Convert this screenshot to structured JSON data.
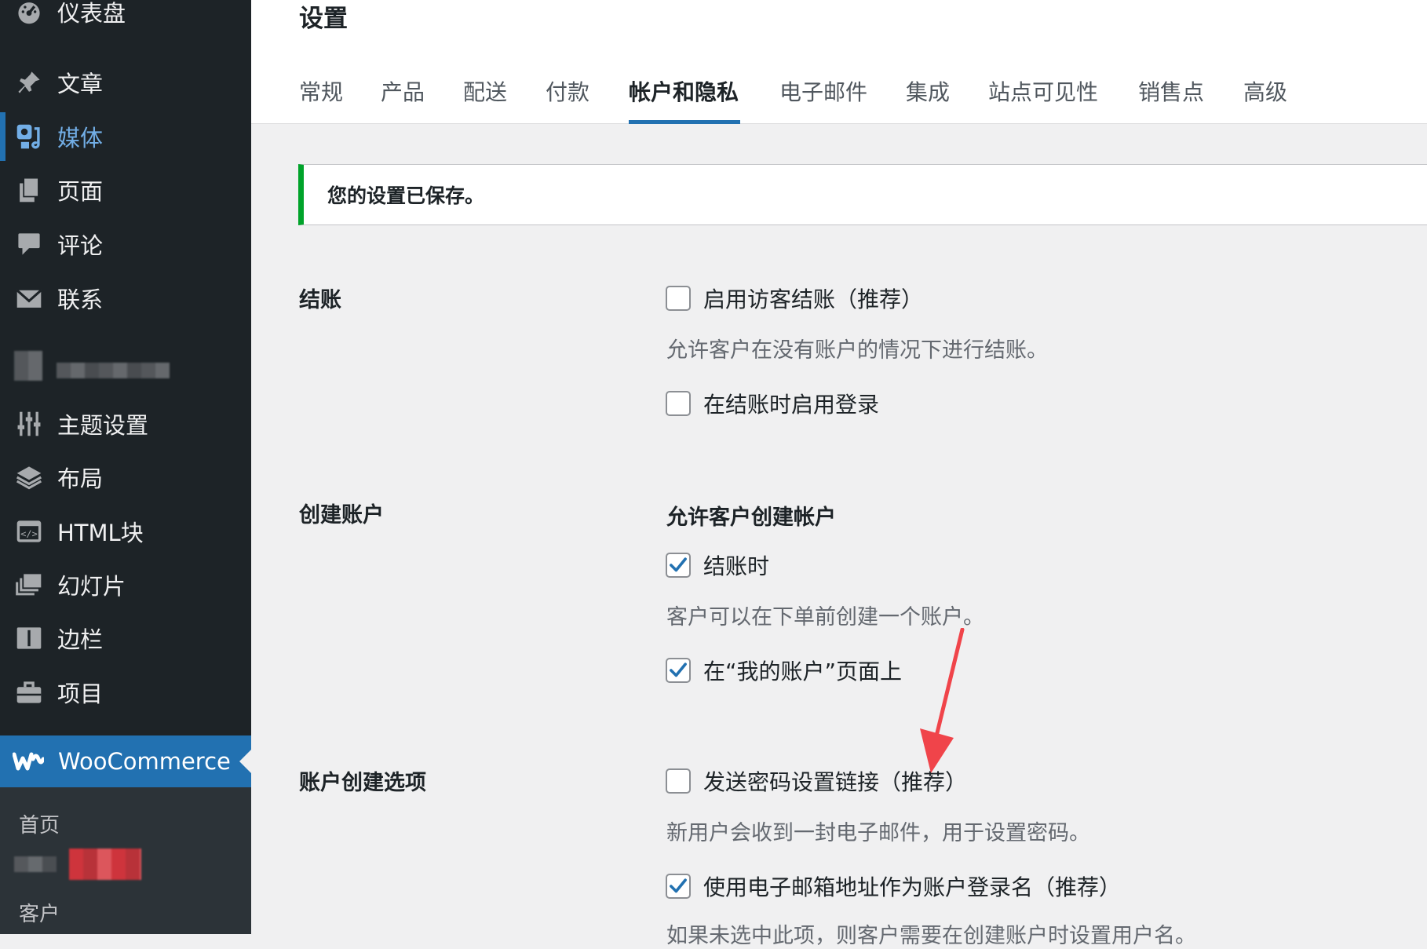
{
  "sidebar": {
    "items": [
      {
        "label": "仪表盘",
        "icon": "dashboard-icon"
      },
      {
        "label": "文章",
        "icon": "pin-icon"
      },
      {
        "label": "媒体",
        "icon": "media-icon"
      },
      {
        "label": "页面",
        "icon": "page-icon"
      },
      {
        "label": "评论",
        "icon": "comment-icon"
      },
      {
        "label": "联系",
        "icon": "mail-icon"
      },
      {
        "label": "主题设置",
        "icon": "sliders-icon"
      },
      {
        "label": "布局",
        "icon": "layers-icon"
      },
      {
        "label": "HTML块",
        "icon": "html-block-icon"
      },
      {
        "label": "幻灯片",
        "icon": "slides-icon"
      },
      {
        "label": "边栏",
        "icon": "sidebar-icon"
      },
      {
        "label": "项目",
        "icon": "briefcase-icon"
      }
    ],
    "woocommerce": {
      "label": "WooCommerce",
      "icon": "woocommerce-icon"
    },
    "submenu": [
      {
        "label": "首页"
      },
      {
        "label": "客户"
      }
    ]
  },
  "header": {
    "title": "设置",
    "tabs": [
      {
        "label": "常规"
      },
      {
        "label": "产品"
      },
      {
        "label": "配送"
      },
      {
        "label": "付款"
      },
      {
        "label": "帐户和隐私"
      },
      {
        "label": "电子邮件"
      },
      {
        "label": "集成"
      },
      {
        "label": "站点可见性"
      },
      {
        "label": "销售点"
      },
      {
        "label": "高级"
      }
    ],
    "active_tab": "帐户和隐私"
  },
  "notice": {
    "text": "您的设置已保存。",
    "color": "#00a32a"
  },
  "sections": {
    "checkout": {
      "label": "结账",
      "guest_checkout": {
        "label": "启用访客结账（推荐）",
        "checked": false
      },
      "guest_checkout_desc": "允许客户在没有账户的情况下进行结账。",
      "login_at_checkout": {
        "label": "在结账时启用登录",
        "checked": false
      }
    },
    "account_creation": {
      "label": "创建账户",
      "subheading": "允许客户创建帐户",
      "at_checkout": {
        "label": "结账时",
        "checked": true
      },
      "at_checkout_desc": "客户可以在下单前创建一个账户。",
      "on_my_account": {
        "label": "在“我的账户”页面上",
        "checked": true
      }
    },
    "account_options": {
      "label": "账户创建选项",
      "send_password_link": {
        "label": "发送密码设置链接（推荐）",
        "checked": false
      },
      "send_password_link_desc": "新用户会收到一封电子邮件，用于设置密码。",
      "email_as_username": {
        "label": "使用电子邮箱地址作为账户登录名（推荐）",
        "checked": true
      },
      "email_as_username_desc": "如果未选中此项，则客户需要在创建账户时设置用户名。"
    }
  },
  "colors": {
    "sidebar_bg": "#1d2327",
    "accent": "#2271b1",
    "checkmark": "#2271b1",
    "annotation_arrow": "#f0444a"
  }
}
